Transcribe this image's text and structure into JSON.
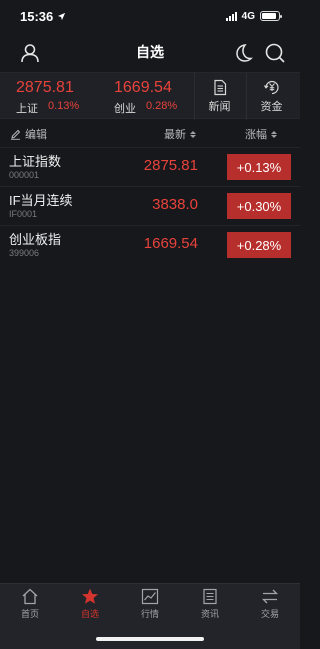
{
  "status": {
    "time": "15:36",
    "network": "4G"
  },
  "nav": {
    "title": "自选"
  },
  "summary": {
    "indices": [
      {
        "value": "2875.81",
        "name": "上证",
        "change": "0.13%"
      },
      {
        "value": "1669.54",
        "name": "创业",
        "change": "0.28%"
      }
    ],
    "news_label": "新闻",
    "funds_label": "资金"
  },
  "columns": {
    "edit": "编辑",
    "latest": "最新",
    "change": "涨幅"
  },
  "stocks": [
    {
      "name": "上证指数",
      "code": "000001",
      "price": "2875.81",
      "change": "+0.13%"
    },
    {
      "name": "IF当月连续",
      "code": "IF0001",
      "price": "3838.0",
      "change": "+0.30%"
    },
    {
      "name": "创业板指",
      "code": "399006",
      "price": "1669.54",
      "change": "+0.28%"
    }
  ],
  "tabs": [
    {
      "label": "首页",
      "icon": "home-icon"
    },
    {
      "label": "自选",
      "icon": "star-icon"
    },
    {
      "label": "行情",
      "icon": "chart-icon"
    },
    {
      "label": "资讯",
      "icon": "news-icon"
    },
    {
      "label": "交易",
      "icon": "exchange-icon"
    }
  ],
  "colors": {
    "up": "#e8423b",
    "badge": "#b72f2c",
    "active_tab": "#d6352f",
    "background": "#17181c"
  }
}
